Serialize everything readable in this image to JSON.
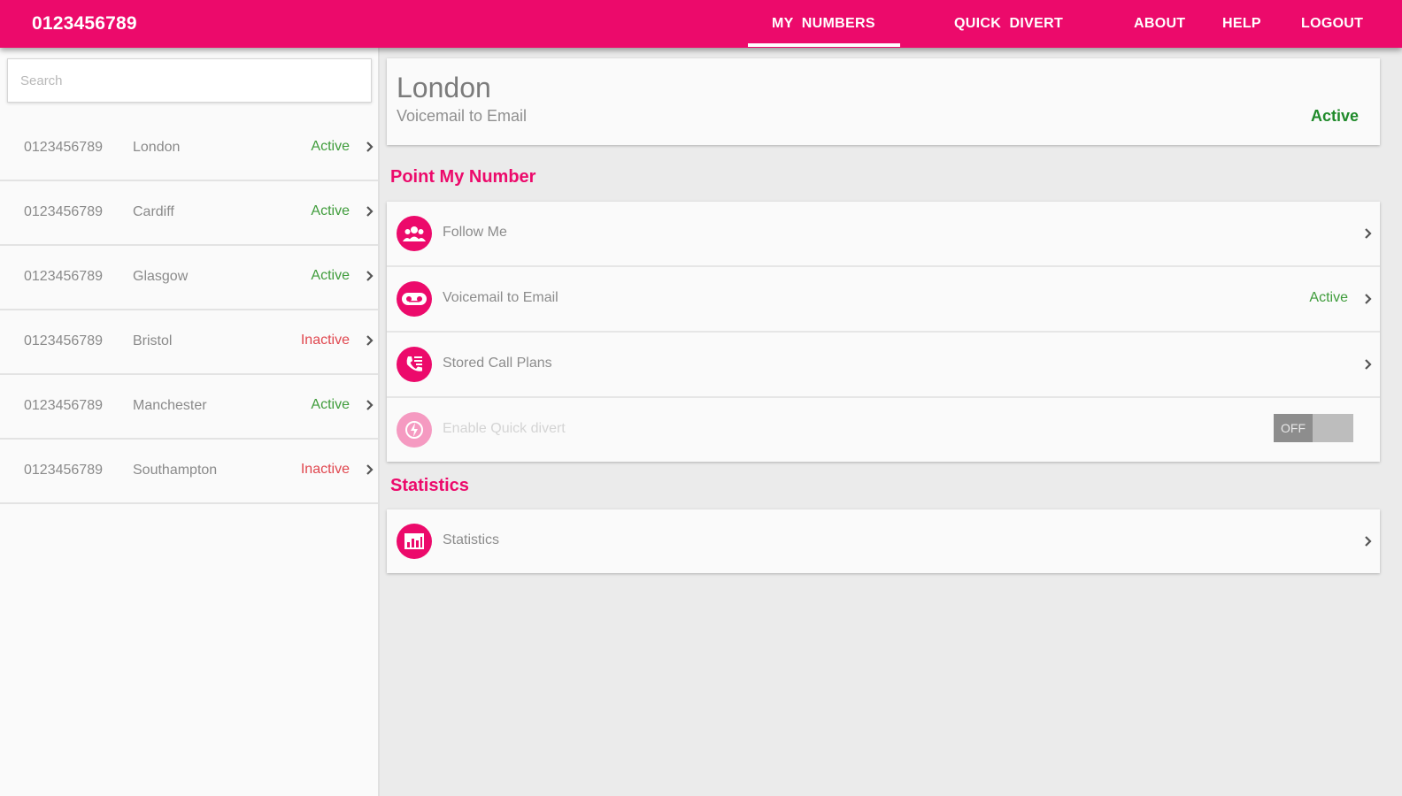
{
  "app": {
    "title": "0123456789"
  },
  "nav": {
    "my_numbers": "MY  NUMBERS",
    "quick_divert": "QUICK  DIVERT",
    "about": "ABOUT",
    "help": "HELP",
    "logout": "LOGOUT"
  },
  "search": {
    "placeholder": "Search",
    "value": ""
  },
  "numbers": [
    {
      "number": "0123456789",
      "city": "London",
      "status": "Active"
    },
    {
      "number": "0123456789",
      "city": "Cardiff",
      "status": "Active"
    },
    {
      "number": "0123456789",
      "city": "Glasgow",
      "status": "Active"
    },
    {
      "number": "0123456789",
      "city": "Bristol",
      "status": "Inactive"
    },
    {
      "number": "0123456789",
      "city": "Manchester",
      "status": "Active"
    },
    {
      "number": "0123456789",
      "city": "Southampton",
      "status": "Inactive"
    }
  ],
  "detail": {
    "title": "London",
    "subtitle": "Voicemail to Email",
    "status": "Active"
  },
  "point_my_number": {
    "heading": "Point My Number",
    "options": [
      {
        "label": "Follow Me",
        "status": "",
        "icon": "group-icon"
      },
      {
        "label": "Voicemail to Email",
        "status": "Active",
        "icon": "voicemail-icon"
      },
      {
        "label": "Stored Call Plans",
        "status": "",
        "icon": "phone-list-icon"
      },
      {
        "label": "Enable Quick divert",
        "status": "",
        "icon": "quick-divert-icon"
      }
    ],
    "toggle_label": "OFF"
  },
  "statistics": {
    "heading": "Statistics",
    "item_label": "Statistics",
    "icon": "chart-icon"
  },
  "colors": {
    "brand": "#ec0a6b",
    "active": "#3f9c3b",
    "inactive": "#e0474f"
  }
}
